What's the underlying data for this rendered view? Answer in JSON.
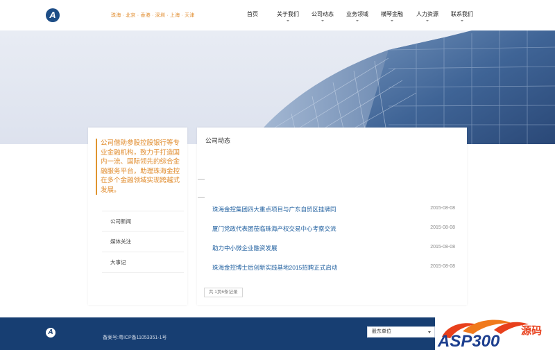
{
  "header": {
    "logo_letter": "A",
    "cities": "珠海 · 北京 · 香港 · 深圳 · 上海 · 天津",
    "nav": [
      {
        "label": "首页",
        "has_caret": false
      },
      {
        "label": "关于我们",
        "has_caret": true
      },
      {
        "label": "公司动态",
        "has_caret": true
      },
      {
        "label": "业务领域",
        "has_caret": true
      },
      {
        "label": "横琴金融",
        "has_caret": true
      },
      {
        "label": "人力资源",
        "has_caret": true
      },
      {
        "label": "联系我们",
        "has_caret": true
      }
    ]
  },
  "sidebar": {
    "intro": "公司借助参股控股银行等专业金融机构，致力于打造国内一流、国际领先的综合金融服务平台，助理珠海金控在多个金融领域实现跨越式发展。",
    "items": [
      {
        "label": "公司新闻"
      },
      {
        "label": "媒体关注"
      },
      {
        "label": "大事记"
      }
    ]
  },
  "main": {
    "title": "公司动态",
    "news": [
      {
        "title": "珠海金控集团四大重点项目与广东自贸区挂牌同",
        "date": "2015-08-08"
      },
      {
        "title": "厦门党政代表团莅临珠海产权交易中心考察交流",
        "date": "2015-08-08"
      },
      {
        "title": "助力中小微企业融资发展",
        "date": "2015-08-08"
      },
      {
        "title": "珠海金控博士后创新实践基地2015招聘正式启动",
        "date": "2015-08-08"
      }
    ],
    "pager": "共 1页6条记录"
  },
  "footer": {
    "logo_letter": "A",
    "icp": "备案号:粤ICP备11053351-1号",
    "select_value": "股东单位"
  },
  "watermark": {
    "text": "ASP300",
    "suffix": "源码"
  },
  "colors": {
    "accent_orange": "#e08a2a",
    "link_blue": "#1f5f9f",
    "footer_navy": "#173e72"
  }
}
